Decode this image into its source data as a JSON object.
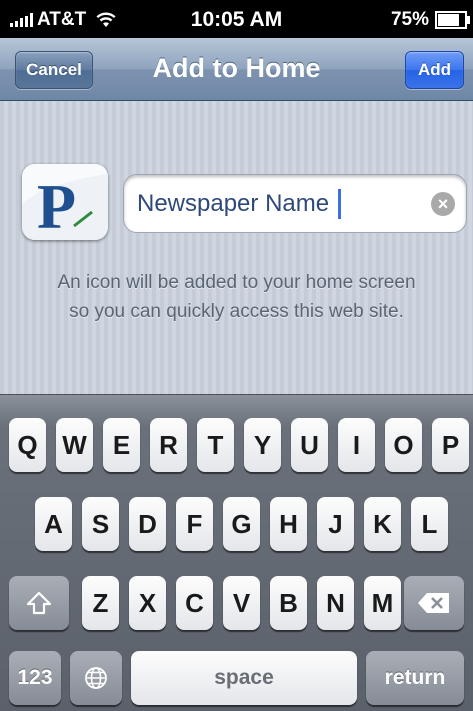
{
  "status_bar": {
    "carrier": "AT&T",
    "time": "10:05 AM",
    "battery": "75%"
  },
  "nav": {
    "title": "Add to Home",
    "cancel_label": "Cancel",
    "add_label": "Add"
  },
  "bookmark": {
    "name_value": "Newspaper Name",
    "icon_letter": "P",
    "info_line1": "An icon will be added to your home screen",
    "info_line2": "so you can quickly access this web site."
  },
  "keyboard": {
    "row1": [
      "Q",
      "W",
      "E",
      "R",
      "T",
      "Y",
      "U",
      "I",
      "O",
      "P"
    ],
    "row2": [
      "A",
      "S",
      "D",
      "F",
      "G",
      "H",
      "J",
      "K",
      "L"
    ],
    "row3": [
      "Z",
      "X",
      "C",
      "V",
      "B",
      "N",
      "M"
    ],
    "numbers_label": "123",
    "space_label": "space",
    "return_label": "return"
  },
  "colors": {
    "nav_blue": "#6f87a6",
    "add_blue": "#2563e6",
    "keyboard_bg": "#5b616a"
  }
}
